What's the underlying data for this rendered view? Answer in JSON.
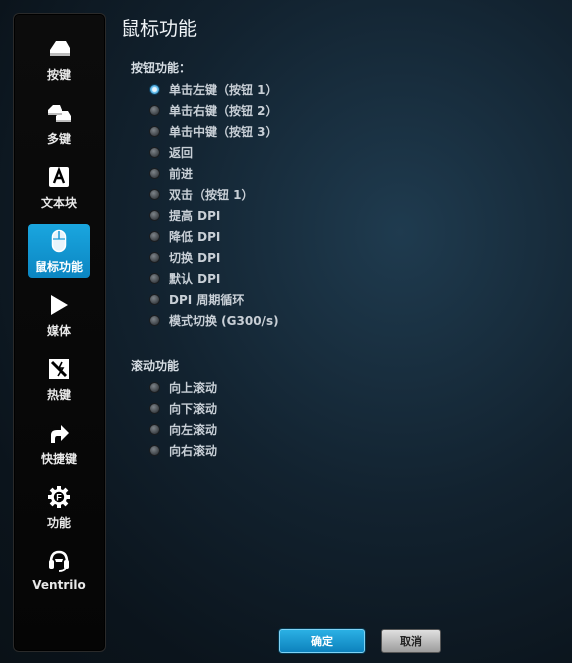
{
  "sidebar": {
    "items": [
      {
        "label": "按键",
        "icon": "key-icon",
        "active": false
      },
      {
        "label": "多键",
        "icon": "multikey-icon",
        "active": false
      },
      {
        "label": "文本块",
        "icon": "text-block-icon",
        "active": false
      },
      {
        "label": "鼠标功能",
        "icon": "mouse-icon",
        "active": true
      },
      {
        "label": "媒体",
        "icon": "play-icon",
        "active": false
      },
      {
        "label": "热键",
        "icon": "hotkey-icon",
        "active": false
      },
      {
        "label": "快捷键",
        "icon": "shortcut-arrow-icon",
        "active": false
      },
      {
        "label": "功能",
        "icon": "function-gear-icon",
        "active": false
      },
      {
        "label": "Ventrilo",
        "icon": "headset-icon",
        "active": false
      }
    ]
  },
  "main": {
    "title": "鼠标功能",
    "button_section": {
      "title": "按钮功能：",
      "options": [
        {
          "label": "单击左键（按钮 1）",
          "checked": true
        },
        {
          "label": "单击右键（按钮 2）",
          "checked": false
        },
        {
          "label": "单击中键（按钮 3）",
          "checked": false
        },
        {
          "label": "返回",
          "checked": false
        },
        {
          "label": "前进",
          "checked": false
        },
        {
          "label": "双击（按钮 1）",
          "checked": false
        },
        {
          "label": "提高 DPI",
          "checked": false
        },
        {
          "label": "降低 DPI",
          "checked": false
        },
        {
          "label": "切换 DPI",
          "checked": false
        },
        {
          "label": "默认 DPI",
          "checked": false
        },
        {
          "label": "DPI 周期循环",
          "checked": false
        },
        {
          "label": "模式切换 (G300/s)",
          "checked": false
        }
      ]
    },
    "scroll_section": {
      "title": "滚动功能",
      "options": [
        {
          "label": "向上滚动",
          "checked": false
        },
        {
          "label": "向下滚动",
          "checked": false
        },
        {
          "label": "向左滚动",
          "checked": false
        },
        {
          "label": "向右滚动",
          "checked": false
        }
      ]
    }
  },
  "footer": {
    "ok_label": "确定",
    "cancel_label": "取消"
  },
  "colors": {
    "accent": "#129bd6",
    "background": "#122230"
  }
}
